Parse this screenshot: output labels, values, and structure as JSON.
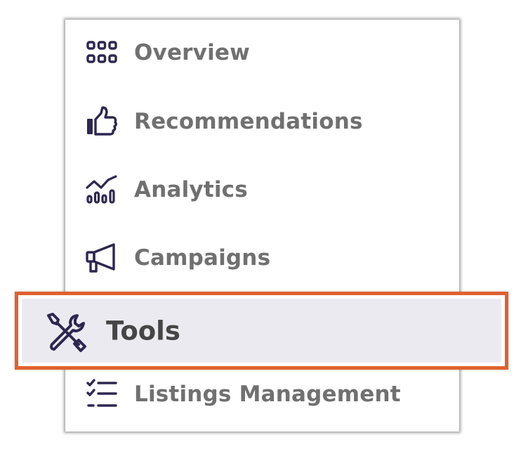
{
  "menu": {
    "items": [
      {
        "label": "Overview",
        "icon": "grid-icon"
      },
      {
        "label": "Recommendations",
        "icon": "thumbs-up-icon"
      },
      {
        "label": "Analytics",
        "icon": "analytics-chart-icon"
      },
      {
        "label": "Campaigns",
        "icon": "megaphone-icon"
      },
      {
        "label": "Tools",
        "icon": "tools-icon",
        "selected": true
      },
      {
        "label": "Listings Management",
        "icon": "checklist-icon"
      }
    ]
  },
  "colors": {
    "icon": "#2e2750",
    "label": "#707070",
    "selected_label": "#454545",
    "selected_bg": "#eceaf1",
    "highlight_border": "#e0612f"
  }
}
